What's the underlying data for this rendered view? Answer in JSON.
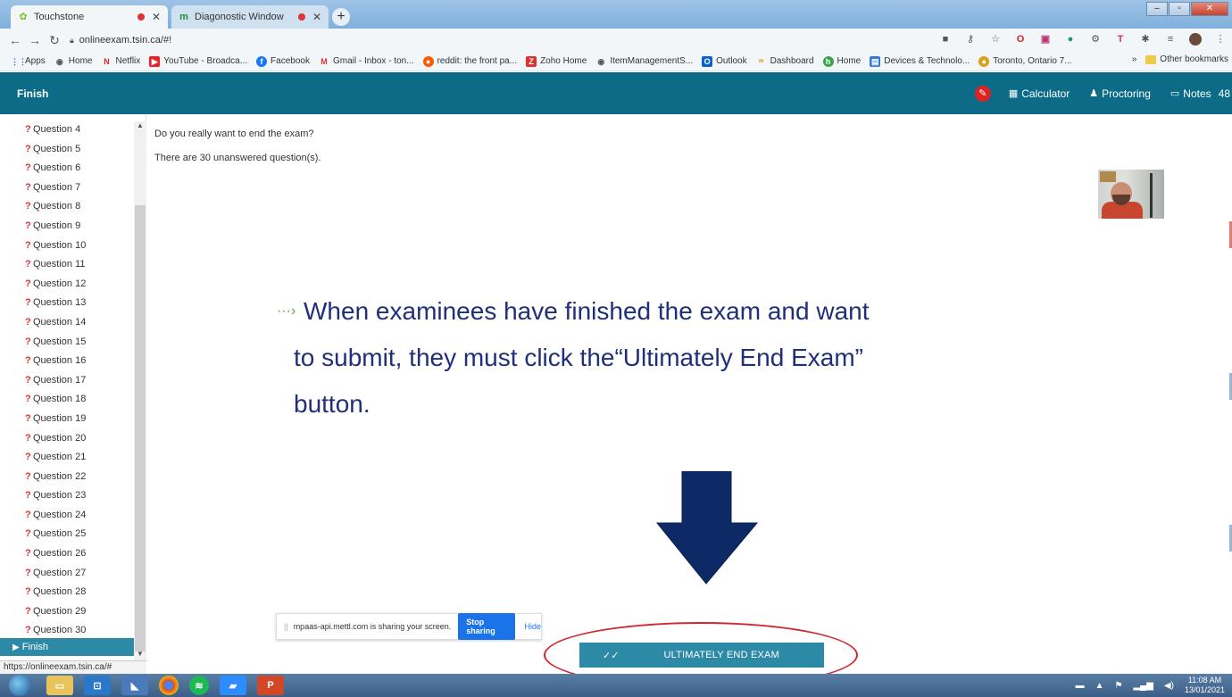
{
  "browser": {
    "tabs": [
      {
        "label": "Touchstone",
        "icon": "leaf-icon"
      },
      {
        "label": "Diagonostic Window",
        "icon": "chart-icon"
      }
    ],
    "url": "onlineexam.tsin.ca/#!",
    "bookmarks": [
      "Apps",
      "Home",
      "Netflix",
      "YouTube - Broadca...",
      "Facebook",
      "Gmail - Inbox - ton...",
      "reddit: the front pa...",
      "Zoho Home",
      "ItemManagementS...",
      "Outlook",
      "Dashboard",
      "Home",
      "Devices & Technolo...",
      "Toronto, Ontario 7..."
    ],
    "other_bookmarks": "Other bookmarks",
    "status_url": "https://onlineexam.tsin.ca/#"
  },
  "header": {
    "title": "Finish",
    "calculator": "Calculator",
    "proctoring": "Proctoring",
    "notes": "Notes",
    "counter": "48"
  },
  "sidebar": {
    "questions": [
      "Question 4",
      "Question 5",
      "Question 6",
      "Question 7",
      "Question 8",
      "Question 9",
      "Question 10",
      "Question 11",
      "Question 12",
      "Question 13",
      "Question 14",
      "Question 15",
      "Question 16",
      "Question 17",
      "Question 18",
      "Question 19",
      "Question 20",
      "Question 21",
      "Question 22",
      "Question 23",
      "Question 24",
      "Question 25",
      "Question 26",
      "Question 27",
      "Question 28",
      "Question 29",
      "Question 30"
    ],
    "finish": "Finish"
  },
  "main": {
    "confirm": "Do you really want to end the exam?",
    "unanswered": "There are 30 unanswered question(s).",
    "annotation_line1": "When examinees have finished the exam and want",
    "annotation_line2": "to submit, they must click the“Ultimately End Exam”",
    "annotation_line3": "button.",
    "end_button": "ULTIMATELY END EXAM"
  },
  "sharebar": {
    "text": "mpaas-api.mettl.com is sharing your screen.",
    "stop": "Stop sharing",
    "hide": "Hide"
  },
  "taskbar": {
    "time": "11:08 AM",
    "date": "13/01/2021"
  },
  "colors": {
    "header_bg": "#0c6b87",
    "accent": "#2d8aa6",
    "annotation": "#1f2f7a",
    "arrow": "#0e2a66",
    "highlight": "#d0272a"
  }
}
